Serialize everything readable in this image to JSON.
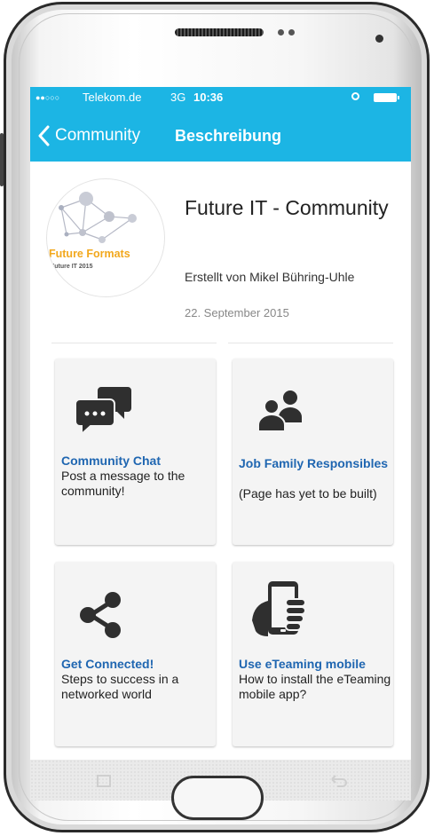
{
  "status": {
    "carrier": "Telekom.de",
    "network": "3G",
    "time": "10:36",
    "accent": "#1cb5e4"
  },
  "nav": {
    "back_label": "Community",
    "title": "Beschreibung",
    "back_icon": "chevron-left-icon"
  },
  "community": {
    "title": "Future IT - Community",
    "author": "Erstellt von Mikel Bühring-Uhle",
    "date": "22. September 2015",
    "logo": {
      "name": "Future Formats",
      "subtitle": "Future IT 2015",
      "color": "#f2a81d"
    }
  },
  "tiles": [
    {
      "icon": "chat-bubbles-icon",
      "title": "Community Chat",
      "description": "Post a message to the community!"
    },
    {
      "icon": "people-icon",
      "title": "Job Family Responsibles",
      "description": "(Page has yet to be built)"
    },
    {
      "icon": "share-icon",
      "title": "Get Connected!",
      "description": "Steps to success in a networked world"
    },
    {
      "icon": "phone-in-hand-icon",
      "title": "Use eTeaming mobile",
      "description": "How to install the eTeaming mobile app?"
    }
  ]
}
